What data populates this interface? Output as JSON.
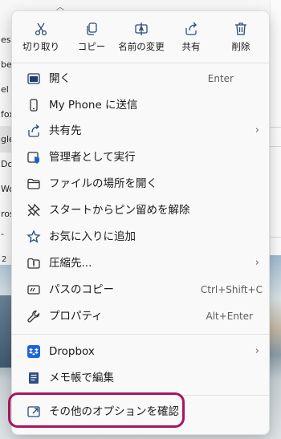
{
  "background": {
    "app_rows": [
      "ess",
      "be",
      "el",
      "fox",
      "gle",
      "Do",
      "Wo",
      "ros",
      "-"
    ],
    "bottom_text": "2"
  },
  "menu": {
    "quick_actions": [
      {
        "id": "cut",
        "label": "切り取り",
        "icon": "scissors-icon"
      },
      {
        "id": "copy",
        "label": "コピー",
        "icon": "copy-icon"
      },
      {
        "id": "rename",
        "label": "名前の変更",
        "icon": "rename-icon"
      },
      {
        "id": "share",
        "label": "共有",
        "icon": "share-icon"
      },
      {
        "id": "delete",
        "label": "削除",
        "icon": "trash-icon"
      }
    ],
    "items": [
      {
        "label": "開く",
        "shortcut": "Enter",
        "icon": "open-window-icon"
      },
      {
        "label": "My Phone に送信",
        "shortcut": "",
        "icon": "phone-icon"
      },
      {
        "label": "共有先",
        "shortcut": "",
        "icon": "share-to-icon",
        "submenu": true
      },
      {
        "label": "管理者として実行",
        "shortcut": "",
        "icon": "shield-run-icon"
      },
      {
        "label": "ファイルの場所を開く",
        "shortcut": "",
        "icon": "folder-icon"
      },
      {
        "label": "スタートからピン留めを解除",
        "shortcut": "",
        "icon": "unpin-icon"
      },
      {
        "label": "お気に入りに追加",
        "shortcut": "",
        "icon": "star-icon"
      },
      {
        "label": "圧縮先...",
        "shortcut": "",
        "icon": "zip-folder-icon",
        "submenu": true
      },
      {
        "label": "パスのコピー",
        "shortcut": "Ctrl+Shift+C",
        "icon": "copy-path-icon"
      },
      {
        "label": "プロパティ",
        "shortcut": "Alt+Enter",
        "icon": "wrench-icon"
      },
      {
        "label": "Dropbox",
        "shortcut": "",
        "icon": "dropbox-icon",
        "submenu": true
      },
      {
        "label": "メモ帳で編集",
        "shortcut": "",
        "icon": "notepad-icon"
      },
      {
        "label": "その他のオプションを確認",
        "shortcut": "",
        "icon": "more-options-icon"
      }
    ],
    "chevron": "›",
    "highlight_color": "#a5175e"
  }
}
